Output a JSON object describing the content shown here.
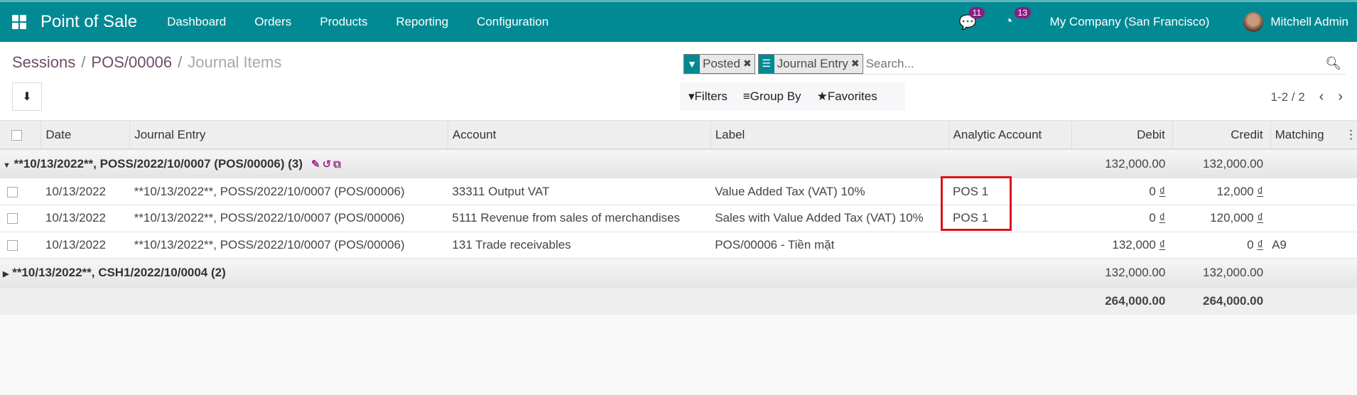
{
  "navbar": {
    "app_title": "Point of Sale",
    "menus": [
      "Dashboard",
      "Orders",
      "Products",
      "Reporting",
      "Configuration"
    ],
    "messages_count": "11",
    "activities_count": "13",
    "company": "My Company (San Francisco)",
    "user": "Mitchell Admin",
    "color": "#028a94"
  },
  "breadcrumb": {
    "items": [
      "Sessions",
      "POS/00006"
    ],
    "current": "Journal Items"
  },
  "search": {
    "facets": [
      {
        "icon": "filter-icon",
        "value": "Posted"
      },
      {
        "icon": "group-by-icon",
        "value": "Journal Entry"
      }
    ],
    "placeholder": "Search..."
  },
  "filters": {
    "filters": "Filters",
    "group_by": "Group By",
    "favorites": "Favorites"
  },
  "pager": {
    "value": "1-2 / 2"
  },
  "table": {
    "columns": [
      "Date",
      "Journal Entry",
      "Account",
      "Label",
      "Analytic Account",
      "Debit",
      "Credit",
      "Matching"
    ],
    "groups": [
      {
        "label": "**10/13/2022**, POSS/2022/10/0007 (POS/00006) (3)",
        "debit": "132,000.00",
        "credit": "132,000.00",
        "expanded": true,
        "rows": [
          {
            "date": "10/13/2022",
            "entry": "**10/13/2022**, POSS/2022/10/0007 (POS/00006)",
            "account": "33311 Output VAT",
            "label": "Value Added Tax (VAT) 10%",
            "analytic": "POS 1",
            "debit": "0",
            "credit": "12,000",
            "matching": ""
          },
          {
            "date": "10/13/2022",
            "entry": "**10/13/2022**, POSS/2022/10/0007 (POS/00006)",
            "account": "5111 Revenue from sales of merchandises",
            "label": "Sales with Value Added Tax (VAT) 10%",
            "analytic": "POS 1",
            "debit": "0",
            "credit": "120,000",
            "matching": ""
          },
          {
            "date": "10/13/2022",
            "entry": "**10/13/2022**, POSS/2022/10/0007 (POS/00006)",
            "account": "131 Trade receivables",
            "label": "POS/00006 - Tiền mặt",
            "analytic": "",
            "debit": "132,000",
            "credit": "0",
            "matching": "A9"
          }
        ]
      },
      {
        "label": "**10/13/2022**, CSH1/2022/10/0004 (2)",
        "debit": "132,000.00",
        "credit": "132,000.00",
        "expanded": false
      }
    ],
    "currency": "₫",
    "totals": {
      "debit": "264,000.00",
      "credit": "264,000.00"
    }
  }
}
